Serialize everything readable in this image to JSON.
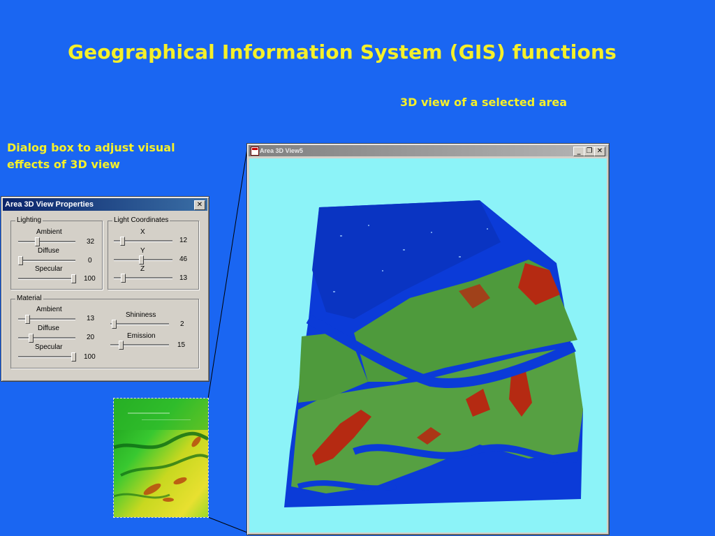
{
  "slide": {
    "title": "Geographical Information System (GIS) functions",
    "caption_3d": "3D view of a selected area",
    "caption_dialog": "Dialog box to adjust visual effects of 3D view"
  },
  "dialog": {
    "title": "Area 3D View Properties",
    "close_glyph": "✕",
    "lighting": {
      "label": "Lighting",
      "ambient": {
        "label": "Ambient",
        "value": "32",
        "level": 0.32
      },
      "diffuse": {
        "label": "Diffuse",
        "value": "0",
        "level": 0.0
      },
      "specular": {
        "label": "Specular",
        "value": "100",
        "level": 1.0
      }
    },
    "light_coordinates": {
      "label": "Light Coordinates",
      "x": {
        "label": "X",
        "value": "12",
        "level": 0.12
      },
      "y": {
        "label": "Y",
        "value": "46",
        "level": 0.46
      },
      "z": {
        "label": "Z",
        "value": "13",
        "level": 0.13
      }
    },
    "material": {
      "label": "Material",
      "ambient": {
        "label": "Ambient",
        "value": "13",
        "level": 0.13
      },
      "diffuse": {
        "label": "Diffuse",
        "value": "20",
        "level": 0.2
      },
      "specular": {
        "label": "Specular",
        "value": "100",
        "level": 1.0
      },
      "shininess": {
        "label": "Shininess",
        "value": "2",
        "level": 0.02
      },
      "emission": {
        "label": "Emission",
        "value": "15",
        "level": 0.15
      }
    }
  },
  "window3d": {
    "title": "Area 3D View5",
    "min_glyph": "_",
    "max_glyph": "❐",
    "close_glyph": "✕"
  },
  "colors": {
    "background": "#1a66f2",
    "caption": "#f5f02a",
    "viewport": "#8cf3f8",
    "terrain_low": "#0a3ad6",
    "terrain_mid": "#4f9a3e",
    "terrain_high": "#b52a12"
  },
  "icons": [
    "close-icon",
    "minimize-icon",
    "maximize-icon",
    "app-icon"
  ]
}
